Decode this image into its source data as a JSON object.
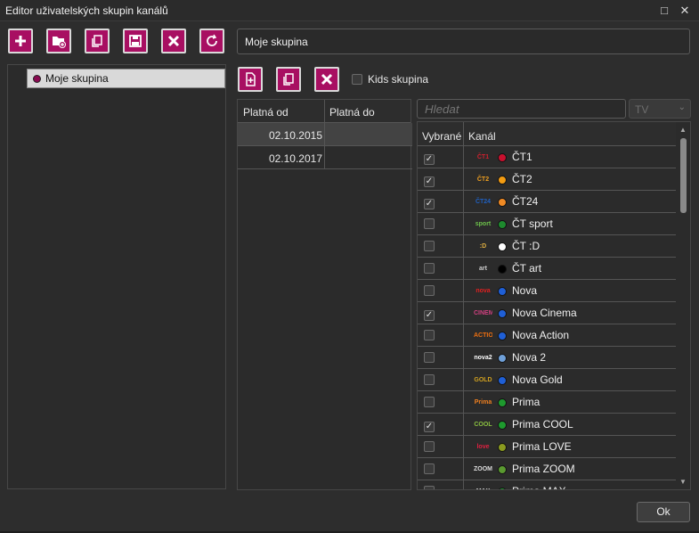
{
  "window": {
    "title": "Editor uživatelských skupin kanálů",
    "maximize_glyph": "□",
    "close_glyph": "✕"
  },
  "toolbar": {
    "buttons": [
      {
        "name": "add-button",
        "icon": "plus-icon"
      },
      {
        "name": "new-folder-button",
        "icon": "folder-plus-icon"
      },
      {
        "name": "copy-button",
        "icon": "copy-icon"
      },
      {
        "name": "save-button",
        "icon": "save-icon"
      },
      {
        "name": "delete-button",
        "icon": "close-icon"
      },
      {
        "name": "refresh-button",
        "icon": "refresh-icon"
      }
    ]
  },
  "group_name": {
    "value": "Moje skupina"
  },
  "tree": {
    "items": [
      {
        "label": "Moje skupina",
        "color": "#8a0b52"
      }
    ]
  },
  "date_toolbar": {
    "buttons": [
      {
        "name": "add-date-button",
        "icon": "add-doc-icon"
      },
      {
        "name": "copy-date-button",
        "icon": "copy-icon"
      },
      {
        "name": "delete-date-button",
        "icon": "close-icon"
      }
    ]
  },
  "kids": {
    "label": "Kids skupina",
    "checked": false
  },
  "dates": {
    "headers": [
      "Platná od",
      "Platná do"
    ],
    "rows": [
      {
        "from": "02.10.2015",
        "to": ""
      },
      {
        "from": "02.10.2017",
        "to": ""
      }
    ]
  },
  "search": {
    "placeholder": "Hledat"
  },
  "filter": {
    "value": "TV",
    "arrow": "⌄"
  },
  "channels": {
    "headers": {
      "selected": "Vybrané",
      "channel": "Kanál"
    },
    "check_glyph": "✓",
    "rows": [
      {
        "name": "ČT1",
        "selected": true,
        "dot": "#c8102e",
        "logo": "ČT1",
        "logo_color": "#d0202e"
      },
      {
        "name": "ČT2",
        "selected": true,
        "dot": "#f39c12",
        "logo": "ČT2",
        "logo_color": "#f0a020"
      },
      {
        "name": "ČT24",
        "selected": true,
        "dot": "#f08a24",
        "logo": "ČT24",
        "logo_color": "#2060c0"
      },
      {
        "name": "ČT sport",
        "selected": false,
        "dot": "#1e8a2e",
        "logo": "sport",
        "logo_color": "#6cc04a"
      },
      {
        "name": "ČT :D",
        "selected": false,
        "dot": "#ffffff",
        "logo": ":D",
        "logo_color": "#e0b040"
      },
      {
        "name": "ČT art",
        "selected": false,
        "dot": "#000000",
        "logo": "art",
        "logo_color": "#cccccc"
      },
      {
        "name": "Nova",
        "selected": false,
        "dot": "#1f5fd6",
        "logo": "nova",
        "logo_color": "#e02020"
      },
      {
        "name": "Nova Cinema",
        "selected": true,
        "dot": "#1f5fd6",
        "logo": "CINEMA",
        "logo_color": "#d04080"
      },
      {
        "name": "Nova Action",
        "selected": false,
        "dot": "#1f5fd6",
        "logo": "ACTION",
        "logo_color": "#f07010"
      },
      {
        "name": "Nova 2",
        "selected": false,
        "dot": "#6fa0d8",
        "logo": "nova2",
        "logo_color": "#ffffff"
      },
      {
        "name": "Nova Gold",
        "selected": false,
        "dot": "#1f5fd6",
        "logo": "GOLD",
        "logo_color": "#d0a020"
      },
      {
        "name": "Prima",
        "selected": false,
        "dot": "#1e9a2e",
        "logo": "Prima",
        "logo_color": "#f08020"
      },
      {
        "name": "Prima COOL",
        "selected": true,
        "dot": "#1e9a2e",
        "logo": "COOL",
        "logo_color": "#8ac040"
      },
      {
        "name": "Prima LOVE",
        "selected": false,
        "dot": "#8a9a20",
        "logo": "love",
        "logo_color": "#e02040"
      },
      {
        "name": "Prima ZOOM",
        "selected": false,
        "dot": "#5a9a30",
        "logo": "ZOOM",
        "logo_color": "#dddddd"
      },
      {
        "name": "Prima MAX",
        "selected": false,
        "dot": "#1e9a2e",
        "logo": "MAX",
        "logo_color": "#dddddd"
      }
    ]
  },
  "scrollbar": {
    "up": "▲",
    "down": "▼"
  },
  "footer": {
    "ok_label": "Ok"
  }
}
